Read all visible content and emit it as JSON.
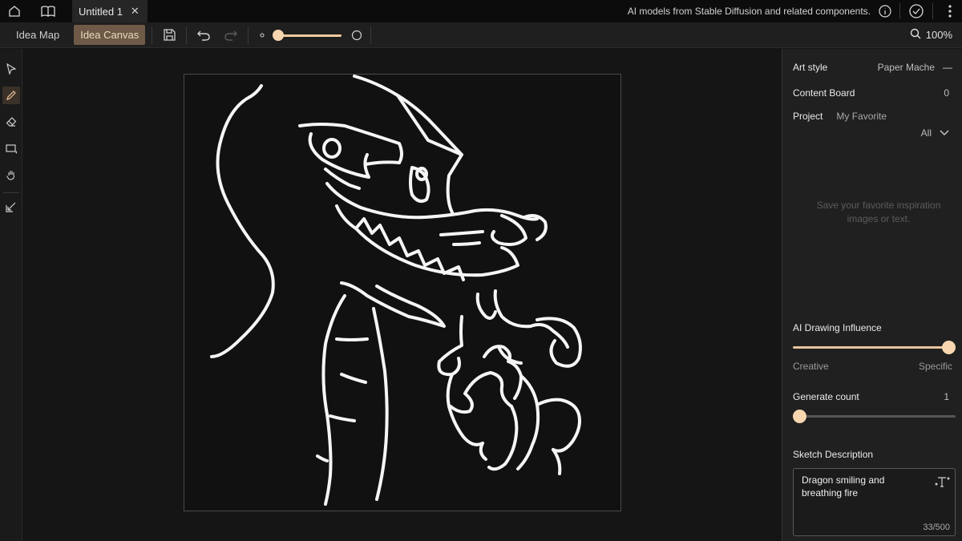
{
  "titlebar": {
    "tab_title": "Untitled 1",
    "tab_close": "✕",
    "notice": "AI models from Stable Diffusion and related components."
  },
  "toolbar": {
    "idea_map": "Idea Map",
    "idea_canvas": "Idea Canvas",
    "zoom": "100%"
  },
  "panel": {
    "art_style_label": "Art style",
    "art_style_value": "Paper Mache",
    "art_style_dash": "—",
    "content_board_label": "Content Board",
    "content_board_count": "0",
    "project_label": "Project",
    "project_value": "My Favorite",
    "filter_value": "All",
    "empty_hint": "Save your favorite inspiration images or text.",
    "influence_label": "AI Drawing Influence",
    "influence_min": "Creative",
    "influence_max": "Specific",
    "influence_level": 1.0,
    "generate_label": "Generate count",
    "generate_value": "1",
    "desc_label": "Sketch Description",
    "desc_text": "Dragon smiling and breathing fire",
    "desc_counter": "33/500"
  },
  "colors": {
    "accent": "#f7d6b0",
    "active_mode": "#6e5a46",
    "background": "#141414"
  }
}
